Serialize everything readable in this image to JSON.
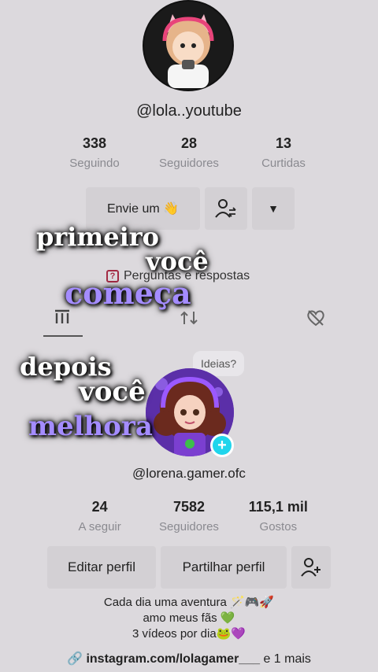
{
  "profile_top": {
    "handle": "@lola..youtube",
    "stats": [
      {
        "value": "338",
        "label": "Seguindo"
      },
      {
        "value": "28",
        "label": "Seguidores"
      },
      {
        "value": "13",
        "label": "Curtidas"
      }
    ],
    "message_button": "Envie um 👋",
    "qa_label": "Perguntas e respostas"
  },
  "overlay": {
    "line1": "primeiro",
    "line2": "você",
    "line3": "começa",
    "line4": "depois",
    "line5": "você",
    "line6": "melhora"
  },
  "profile_bottom": {
    "ideas_bubble": "Ideias?",
    "handle": "@lorena.gamer.ofc",
    "stats": [
      {
        "value": "24",
        "label": "A seguir"
      },
      {
        "value": "7582",
        "label": "Seguidores"
      },
      {
        "value": "115,1 mil",
        "label": "Gostos"
      }
    ],
    "edit_button": "Editar perfil",
    "share_button": "Partilhar perfil",
    "bio": [
      "Cada dia uma aventura 🪄🎮🚀",
      "amo meus fãs 💚",
      "3 vídeos por dia🐸💜"
    ],
    "link": "instagram.com/lolagamer___",
    "link_extra": "e 1 mais"
  }
}
